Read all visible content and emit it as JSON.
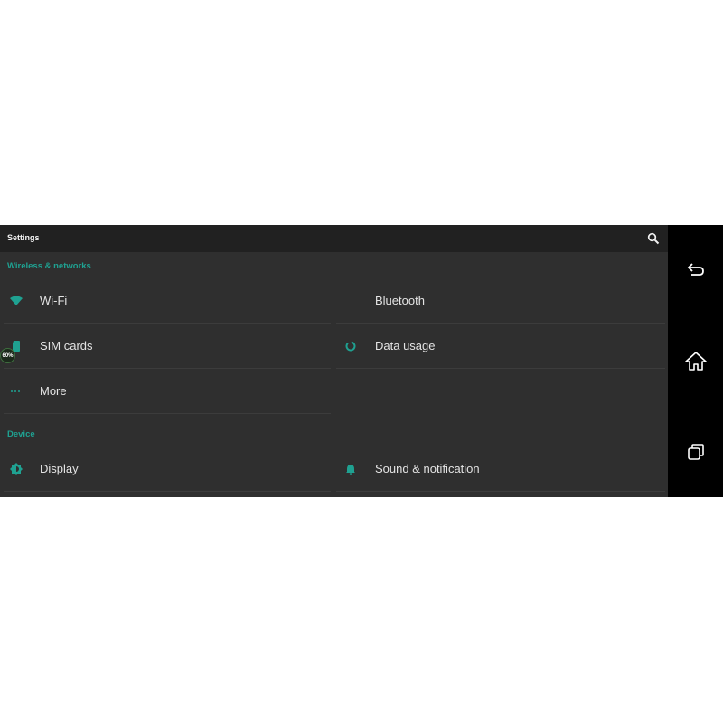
{
  "app": {
    "title": "Settings",
    "search_icon": "search-icon"
  },
  "sections": [
    {
      "header": "Wireless & networks",
      "items": [
        {
          "label": "Wi-Fi",
          "icon": "wifi-icon"
        },
        {
          "label": "Bluetooth",
          "icon": "none"
        },
        {
          "label": "SIM cards",
          "icon": "sim-card-icon"
        },
        {
          "label": "Data usage",
          "icon": "data-usage-icon"
        },
        {
          "label": "More",
          "icon": "more-dots-icon"
        }
      ]
    },
    {
      "header": "Device",
      "items": [
        {
          "label": "Display",
          "icon": "brightness-icon"
        },
        {
          "label": "Sound & notification",
          "icon": "bell-icon"
        }
      ]
    }
  ],
  "overlay_badge": {
    "text": "60%"
  },
  "navbar": {
    "buttons": [
      {
        "name": "back",
        "icon": "back-arrow-icon"
      },
      {
        "name": "home",
        "icon": "home-icon"
      },
      {
        "name": "recents",
        "icon": "recents-icon"
      }
    ]
  },
  "colors": {
    "accent": "#1fa191",
    "background": "#2f2f2f",
    "appbar": "#212121",
    "navbar": "#000000",
    "text": "#e4e4e4"
  }
}
